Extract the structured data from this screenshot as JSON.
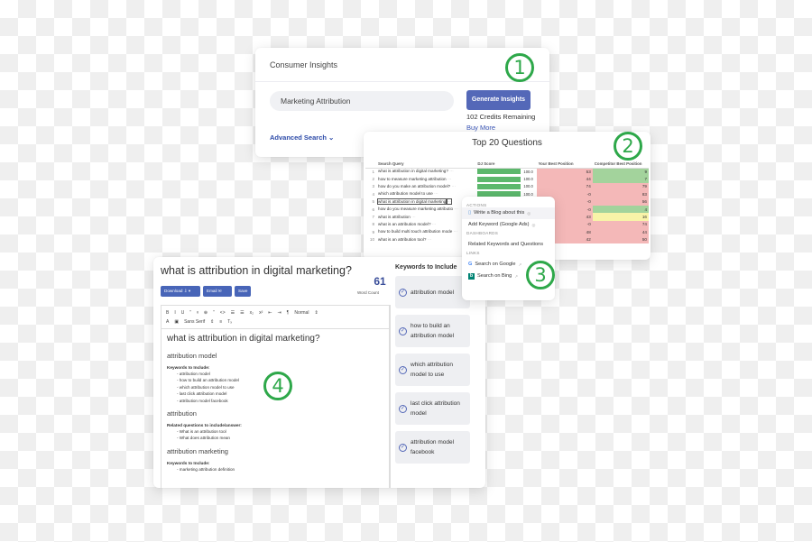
{
  "insights_card": {
    "title": "Consumer Insights",
    "search_value": "Marketing Attribution",
    "generate_label": "Generate Insights",
    "credits": "102 Credits Remaining",
    "buy_more": "Buy More",
    "advanced_search": "Advanced Search",
    "badge": "1"
  },
  "top20_card": {
    "title": "Top 20 Questions",
    "badge": "2",
    "columns": [
      "Search Query",
      "DJ Score",
      "Your Best Position",
      "Competitor Best Position"
    ],
    "rows": [
      {
        "num": "1",
        "query": "what is attribution in digital marketing?",
        "score": "100.0",
        "your": "53",
        "comp": "9",
        "your_color": "#f4b8b8",
        "comp_color": "#a3d39c"
      },
      {
        "num": "2",
        "query": "how to measure marketing attribution",
        "score": "100.0",
        "your": "44",
        "comp": "7",
        "your_color": "#f4b8b8",
        "comp_color": "#a3d39c"
      },
      {
        "num": "3",
        "query": "how do you make an attribution model?",
        "score": "100.0",
        "your": "74",
        "comp": "79",
        "your_color": "#f4b8b8",
        "comp_color": "#f4b8b8"
      },
      {
        "num": "4",
        "query": "which attribution model to use",
        "score": "100.0",
        "your": "-0",
        "comp": "83",
        "your_color": "#f4b8b8",
        "comp_color": "#f4b8b8"
      },
      {
        "num": "5",
        "query": "what is attribution in digital marketing",
        "score": "100.0",
        "your": "-0",
        "comp": "56",
        "your_color": "#f4b8b8",
        "comp_color": "#f4b8b8",
        "selected": true
      },
      {
        "num": "6",
        "query": "how do you measure marketing attributio",
        "score": "100.0",
        "your": "-0",
        "comp": "4",
        "your_color": "#f4b8b8",
        "comp_color": "#a3d39c"
      },
      {
        "num": "7",
        "query": "what is attribution",
        "score": "100.0",
        "your": "43",
        "comp": "16",
        "your_color": "#f4b8b8",
        "comp_color": "#f8f3a8"
      },
      {
        "num": "8",
        "query": "what is an attribution model?",
        "score": "100.0",
        "your": "-0",
        "comp": "74",
        "your_color": "#f4b8b8",
        "comp_color": "#f4b8b8"
      },
      {
        "num": "9",
        "query": "how to build multi touch attribution mode",
        "score": "100.0",
        "your": "48",
        "comp": "44",
        "your_color": "#f4b8b8",
        "comp_color": "#f4b8b8"
      },
      {
        "num": "10",
        "query": "what is an attribution tool?",
        "score": "100.0",
        "your": "42",
        "comp": "50",
        "your_color": "#f4b8b8",
        "comp_color": "#f4b8b8"
      }
    ]
  },
  "context_menu": {
    "badge": "3",
    "actions_label": "ACTIONS",
    "write_blog": "Write a Blog about this",
    "add_keyword": "Add Keyword (Google Ads)",
    "dashboards_label": "DASHBOARDS",
    "related": "Related Keywords and Questions",
    "links_label": "LINKS",
    "search_google": "Search on Google",
    "search_bing": "Search on Bing"
  },
  "doc_card": {
    "badge": "4",
    "title": "what is attribution in digital marketing?",
    "download": "Download",
    "email": "Email",
    "save": "Save",
    "word_count": "61",
    "word_count_label": "Word Count",
    "toolbar": {
      "row1": [
        "B",
        "I",
        "U",
        "”",
        "ᵍ",
        "⊕",
        "”",
        "<>",
        "☰",
        "☰",
        "x₂",
        "x²",
        "⇤",
        "⇥",
        "¶",
        "Normal",
        "⇕"
      ],
      "row2": [
        "A",
        "▣",
        "Sans Serif",
        "⇕",
        "≡",
        "Tₓ"
      ]
    },
    "editor": {
      "heading": "what is attribution in digital marketing?",
      "sections": [
        {
          "subheading": "attribution model",
          "label": "Keywords to Include:",
          "items": [
            "- attribution model",
            "- how to build an attribution model",
            "- which attribution model to use",
            "- last click attribution model",
            "- attribution model facebook"
          ]
        },
        {
          "subheading": "attribution",
          "label": "Related questions to include/answer:",
          "items": [
            "- What is an attribution tool",
            "- What does attribution mean"
          ]
        },
        {
          "subheading": "attribution marketing",
          "label": "Keywords to Include:",
          "items": [
            "- marketing attribution definition"
          ]
        }
      ]
    },
    "keywords_panel": {
      "heading": "Keywords to Include",
      "items": [
        "attribution model",
        "how to build an attribution model",
        "which attribution model to use",
        "last click attribution model",
        "attribution model facebook"
      ]
    }
  }
}
